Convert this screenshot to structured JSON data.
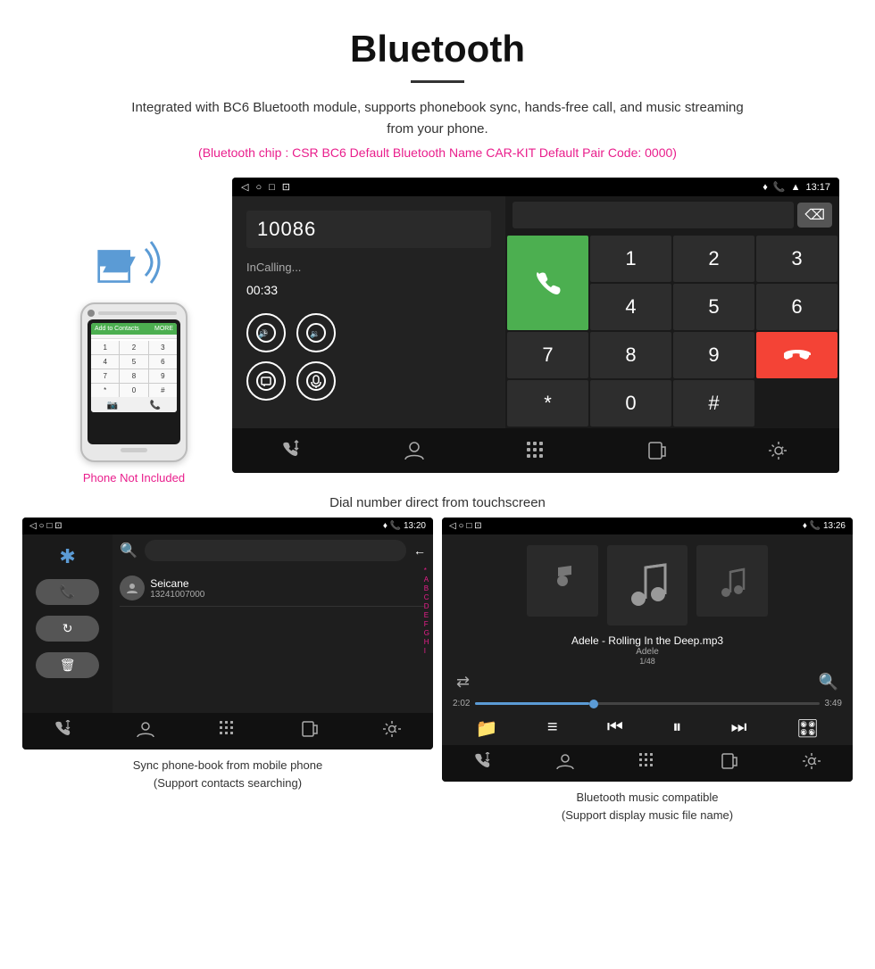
{
  "header": {
    "title": "Bluetooth",
    "description": "Integrated with BC6 Bluetooth module, supports phonebook sync, hands-free call, and music streaming from your phone.",
    "bluetooth_info": "(Bluetooth chip : CSR BC6    Default Bluetooth Name CAR-KIT    Default Pair Code: 0000)"
  },
  "main_screen": {
    "status_bar": {
      "left_icons": [
        "◁",
        "○",
        "□",
        "⊡"
      ],
      "right_icons": [
        "📍",
        "📞",
        "▲",
        "13:17"
      ]
    },
    "dial_number": "10086",
    "call_status": "InCalling...",
    "call_timer": "00:33",
    "numpad_keys": [
      "1",
      "2",
      "3",
      "4",
      "5",
      "6",
      "7",
      "8",
      "9"
    ],
    "special_keys": [
      "*",
      "#",
      "0"
    ],
    "caption": "Dial number direct from touchscreen"
  },
  "phonebook_screen": {
    "status_bar_right": "13:20",
    "contact_name": "Seicane",
    "contact_number": "13241007000",
    "alphabet": [
      "*",
      "A",
      "B",
      "C",
      "D",
      "E",
      "F",
      "G",
      "H",
      "I"
    ],
    "caption_line1": "Sync phone-book from mobile phone",
    "caption_line2": "(Support contacts searching)"
  },
  "music_screen": {
    "status_bar_right": "13:26",
    "song_title": "Adele - Rolling In the Deep.mp3",
    "artist": "Adele",
    "track_count": "1/48",
    "time_elapsed": "2:02",
    "time_total": "3:49",
    "progress_percent": 33,
    "caption_line1": "Bluetooth music compatible",
    "caption_line2": "(Support display music file name)"
  },
  "phone_mockup": {
    "not_included": "Phone Not Included",
    "dial_keys": [
      "1",
      "2",
      "3",
      "4",
      "5",
      "6",
      "7",
      "8",
      "9",
      "*",
      "0",
      "#"
    ]
  },
  "nav_icons": {
    "call_transfer": "📞",
    "contacts": "👤",
    "dialpad": "⊞",
    "transfer": "📋",
    "settings": "⚙"
  }
}
